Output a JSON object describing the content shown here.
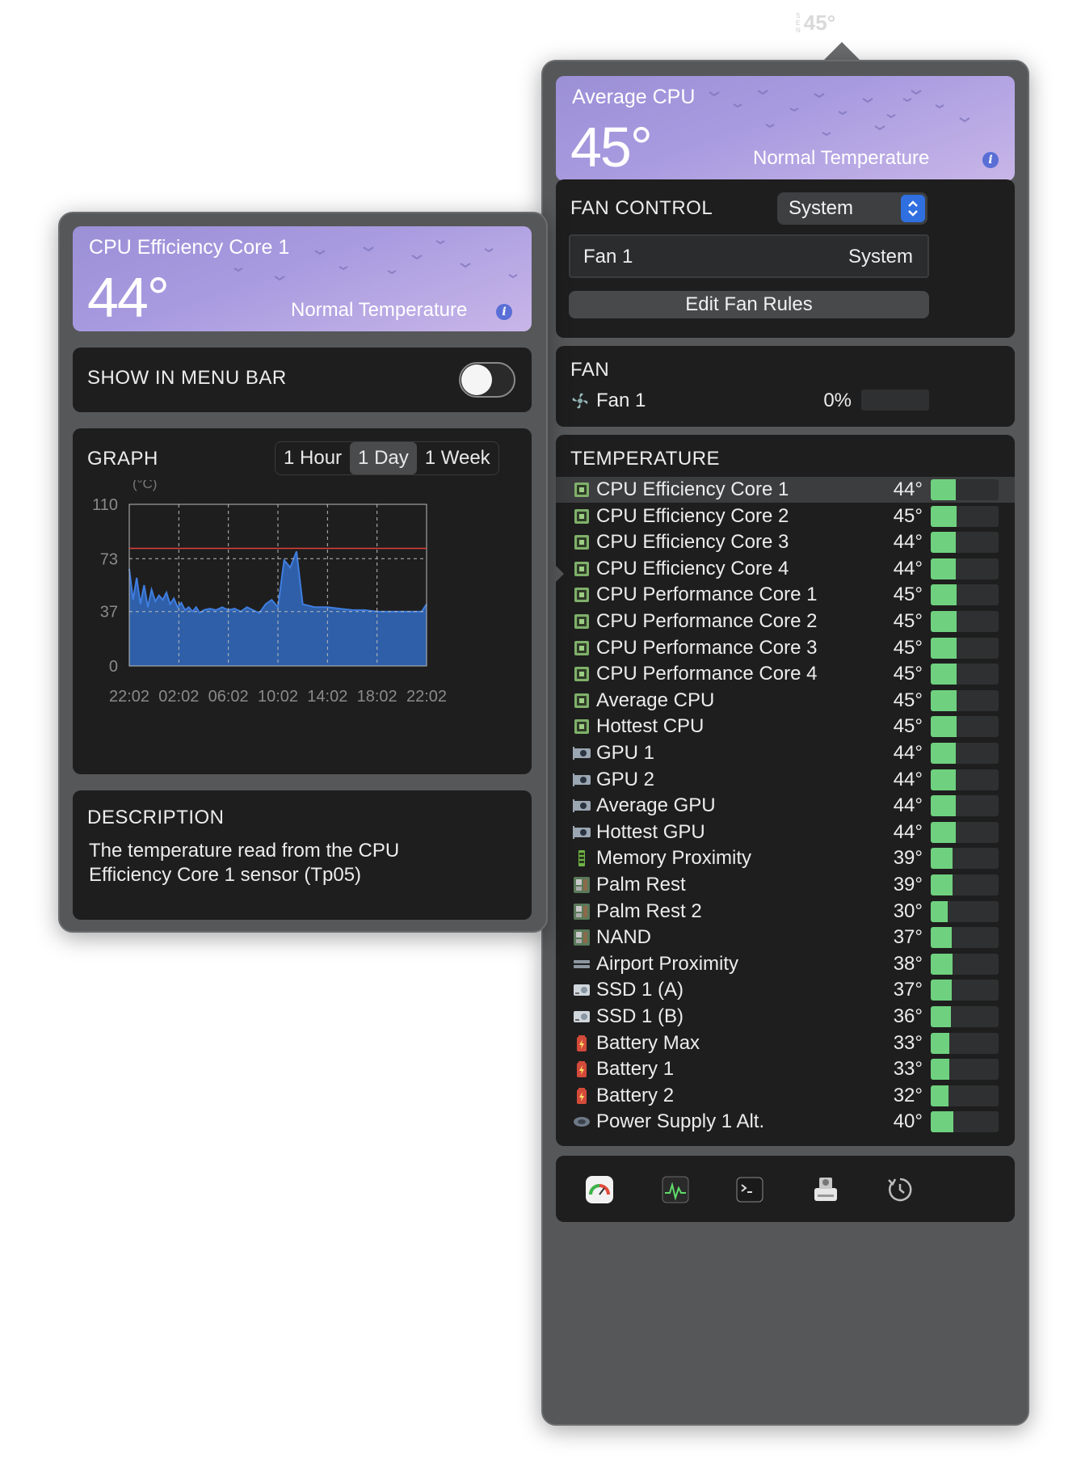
{
  "menubar": {
    "stack_letters": [
      "S",
      "E",
      "N"
    ],
    "value": "45°"
  },
  "average": {
    "title": "Average CPU",
    "value": "45°",
    "status": "Normal Temperature",
    "info": "i"
  },
  "fan_control": {
    "title": "FAN CONTROL",
    "mode": "System",
    "fan_label": "Fan 1",
    "fan_mode": "System",
    "edit_button": "Edit Fan Rules"
  },
  "fan": {
    "title": "FAN",
    "name": "Fan 1",
    "value": "0%",
    "level": 0
  },
  "temperature": {
    "title": "TEMPERATURE",
    "rows": [
      {
        "name": "CPU Efficiency Core 1",
        "value": "44°",
        "level": 44,
        "icon": "cpu-chip-icon",
        "selected": true
      },
      {
        "name": "CPU Efficiency Core 2",
        "value": "45°",
        "level": 45,
        "icon": "cpu-chip-icon"
      },
      {
        "name": "CPU Efficiency Core 3",
        "value": "44°",
        "level": 44,
        "icon": "cpu-chip-icon"
      },
      {
        "name": "CPU Efficiency Core 4",
        "value": "44°",
        "level": 44,
        "icon": "cpu-chip-icon"
      },
      {
        "name": "CPU Performance Core 1",
        "value": "45°",
        "level": 45,
        "icon": "cpu-chip-icon"
      },
      {
        "name": "CPU Performance Core 2",
        "value": "45°",
        "level": 45,
        "icon": "cpu-chip-icon"
      },
      {
        "name": "CPU Performance Core 3",
        "value": "45°",
        "level": 45,
        "icon": "cpu-chip-icon"
      },
      {
        "name": "CPU Performance Core 4",
        "value": "45°",
        "level": 45,
        "icon": "cpu-chip-icon"
      },
      {
        "name": "Average CPU",
        "value": "45°",
        "level": 45,
        "icon": "cpu-chip-icon"
      },
      {
        "name": "Hottest CPU",
        "value": "45°",
        "level": 45,
        "icon": "cpu-chip-icon"
      },
      {
        "name": "GPU 1",
        "value": "44°",
        "level": 44,
        "icon": "gpu-card-icon"
      },
      {
        "name": "GPU 2",
        "value": "44°",
        "level": 44,
        "icon": "gpu-card-icon"
      },
      {
        "name": "Average GPU",
        "value": "44°",
        "level": 44,
        "icon": "gpu-card-icon"
      },
      {
        "name": "Hottest GPU",
        "value": "44°",
        "level": 44,
        "icon": "gpu-card-icon"
      },
      {
        "name": "Memory Proximity",
        "value": "39°",
        "level": 39,
        "icon": "memory-stick-icon"
      },
      {
        "name": "Palm Rest",
        "value": "39°",
        "level": 39,
        "icon": "motherboard-icon"
      },
      {
        "name": "Palm Rest 2",
        "value": "30°",
        "level": 30,
        "icon": "motherboard-icon"
      },
      {
        "name": "NAND",
        "value": "37°",
        "level": 37,
        "icon": "motherboard-icon"
      },
      {
        "name": "Airport Proximity",
        "value": "38°",
        "level": 38,
        "icon": "airport-card-icon"
      },
      {
        "name": "SSD 1 (A)",
        "value": "37°",
        "level": 37,
        "icon": "ssd-drive-icon"
      },
      {
        "name": "SSD 1 (B)",
        "value": "36°",
        "level": 36,
        "icon": "ssd-drive-icon"
      },
      {
        "name": "Battery Max",
        "value": "33°",
        "level": 33,
        "icon": "battery-icon"
      },
      {
        "name": "Battery 1",
        "value": "33°",
        "level": 33,
        "icon": "battery-icon"
      },
      {
        "name": "Battery 2",
        "value": "32°",
        "level": 32,
        "icon": "battery-icon"
      },
      {
        "name": "Power Supply 1 Alt.",
        "value": "40°",
        "level": 40,
        "icon": "power-supply-icon"
      }
    ]
  },
  "toolbar": {
    "items": [
      "gauge-icon",
      "activity-monitor-icon",
      "terminal-icon",
      "disk-utility-icon",
      "history-icon"
    ]
  },
  "detail": {
    "title": "CPU Efficiency Core 1",
    "value": "44°",
    "status": "Normal Temperature",
    "info": "i",
    "menubar_label": "SHOW IN MENU BAR",
    "menubar_on": false,
    "graph_title": "GRAPH",
    "ranges": [
      "1 Hour",
      "1 Day",
      "1 Week"
    ],
    "active_range": "1 Day",
    "description_title": "DESCRIPTION",
    "description": "The temperature read from the CPU Efficiency Core 1 sensor (Tp05)"
  },
  "chart_data": {
    "type": "area",
    "ylabel": "(°C)",
    "yticks": [
      110,
      73,
      37,
      0
    ],
    "ylim": [
      0,
      110
    ],
    "xticks": [
      "22:02",
      "02:02",
      "06:02",
      "10:02",
      "14:02",
      "18:02",
      "22:02"
    ],
    "threshold": 80,
    "threshold_color": "#e0413a",
    "fill_color": "#2f5fa8",
    "line_color": "#3f7ee0",
    "series": [
      {
        "x": [
          0,
          0.3,
          0.6,
          0.9,
          1.2,
          1.5,
          1.8,
          2.1,
          2.4,
          2.7,
          3.0,
          3.3,
          3.6,
          3.9,
          4.2,
          4.5,
          4.8,
          5.1,
          5.4,
          5.7,
          6.0,
          6.5,
          7.0,
          7.5,
          8.0,
          8.5,
          9.0,
          9.5,
          10.0,
          10.5,
          11.0,
          11.5,
          12.0,
          12.5,
          13.0,
          13.5,
          14.0,
          14.5,
          15.0,
          16.0,
          17.0,
          18.0,
          19.0,
          20.0,
          21.0,
          22.0,
          23.0,
          23.6,
          24.0
        ],
        "values": [
          66,
          45,
          60,
          42,
          55,
          40,
          52,
          44,
          48,
          45,
          50,
          42,
          46,
          40,
          43,
          38,
          40,
          37,
          40,
          36,
          38,
          39,
          38,
          40,
          38,
          39,
          37,
          40,
          38,
          36,
          42,
          45,
          40,
          72,
          67,
          78,
          42,
          41,
          40,
          40,
          39,
          38,
          38,
          37,
          37,
          37,
          37,
          37,
          42
        ]
      }
    ]
  },
  "colors": {
    "accent": "#2f6fe0",
    "bar_green": "#6fd17f",
    "card": "#1e1e1e",
    "panel": "#555759"
  }
}
